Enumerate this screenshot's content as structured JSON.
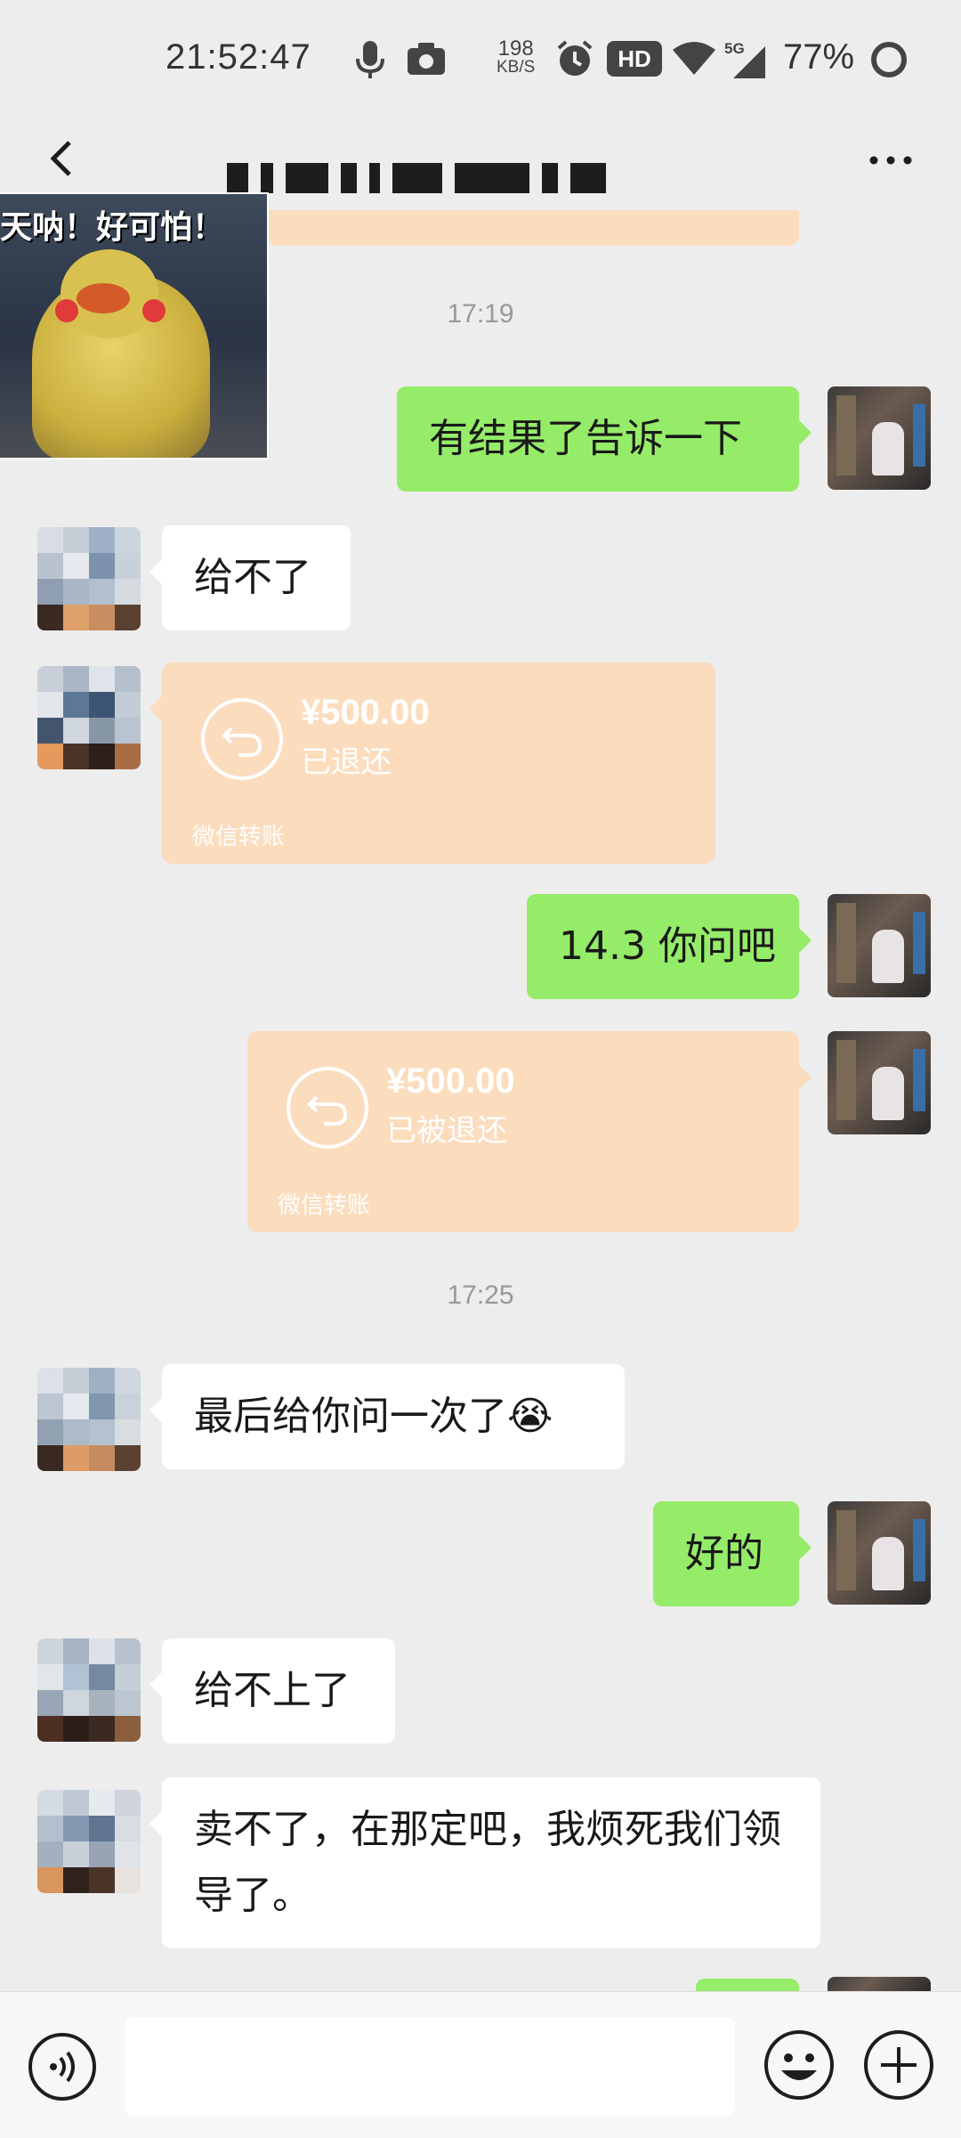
{
  "status_bar": {
    "time": "21:52:47",
    "net_speed_value": "198",
    "net_speed_unit": "KB/S",
    "hd_label": "HD",
    "network_label": "5G",
    "battery": "77%"
  },
  "header": {
    "title": ""
  },
  "sticker": {
    "text": "天呐！好可怕！"
  },
  "messages": {
    "ts1": "17:19",
    "m1": "有结果了告诉一下",
    "m2": "给不了",
    "transfer1": {
      "amount": "¥500.00",
      "status": "已退还",
      "footer": "微信转账"
    },
    "m3": "14.3 你问吧",
    "transfer2": {
      "amount": "¥500.00",
      "status": "已被退还",
      "footer": "微信转账"
    },
    "ts2": "17:25",
    "m4": "最后给你问一次了😭",
    "m5": "好的",
    "m6": "给不上了",
    "m7": "卖不了，在那定吧，我烦死我们领导了。"
  },
  "colors": {
    "background": "#ededed",
    "sent_bubble": "#95ec69",
    "received_bubble": "#ffffff",
    "transfer_card": "#fbdcbd",
    "timestamp": "#999999"
  },
  "icons": {
    "back": "chevron-left-icon",
    "more": "more-dots-icon",
    "voice": "voice-icon",
    "emoji": "emoji-icon",
    "plus": "plus-icon",
    "transfer": "return-arrow-icon"
  }
}
